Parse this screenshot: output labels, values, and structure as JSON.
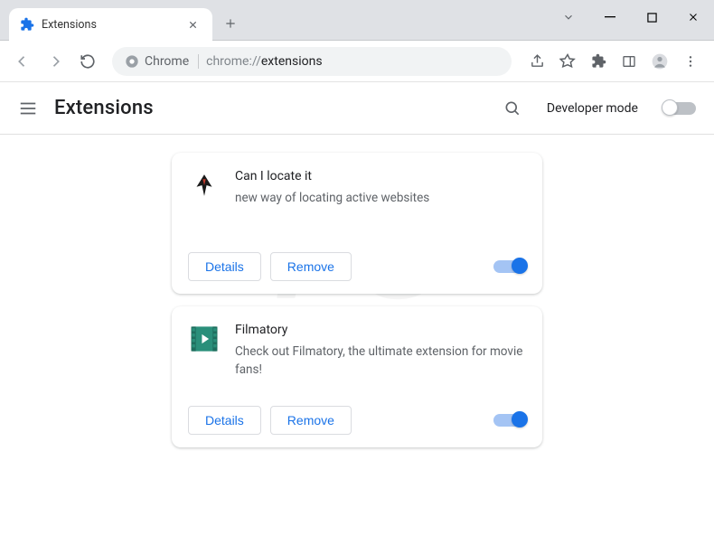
{
  "window": {
    "tab_title": "Extensions",
    "chrome_label": "Chrome",
    "url_host": "chrome://",
    "url_path": "extensions"
  },
  "header": {
    "title": "Extensions",
    "developer_mode_label": "Developer mode",
    "developer_mode_on": false
  },
  "buttons": {
    "details": "Details",
    "remove": "Remove"
  },
  "extensions": [
    {
      "id": "can-i-locate-it",
      "name": "Can I locate it",
      "description": "new way of locating active websites",
      "enabled": true,
      "icon": "wings"
    },
    {
      "id": "filmatory",
      "name": "Filmatory",
      "description": "Check out Filmatory, the ultimate extension for movie fans!",
      "enabled": true,
      "icon": "film"
    }
  ],
  "watermark": {
    "top": "PC",
    "bottom": "risk.com"
  }
}
